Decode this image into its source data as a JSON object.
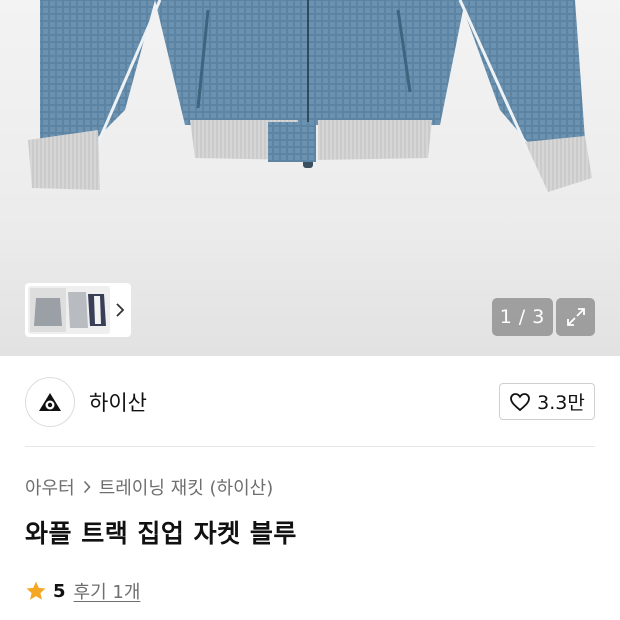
{
  "gallery": {
    "current": "1",
    "separator": "/",
    "total": "3",
    "product_image": "waffle-track-jacket-blue",
    "colors": {
      "jacket": "#5f87a4",
      "rib": "#d8d8d8",
      "background": "#ececec"
    }
  },
  "seller": {
    "name": "하이산",
    "like_count": "3.3만"
  },
  "breadcrumb": {
    "category": "아우터",
    "subcategory": "트레이닝 재킷 (하이산)"
  },
  "product": {
    "title": "와플 트랙 집업 자켓 블루"
  },
  "rating": {
    "score": "5",
    "reviews_label": "후기 1개",
    "star_color": "#f5a623"
  }
}
